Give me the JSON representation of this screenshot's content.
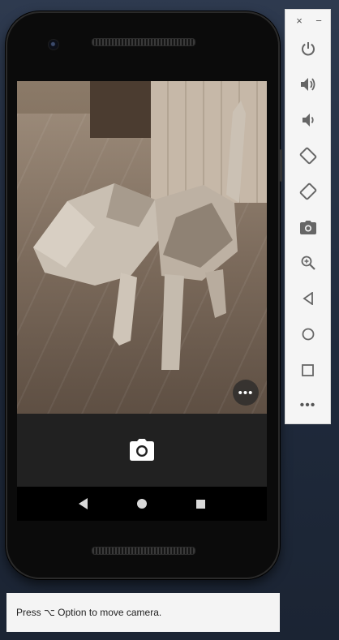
{
  "phone": {
    "nav": {
      "back": "back-icon",
      "home": "home-icon",
      "recents": "recents-icon"
    },
    "camera_app": {
      "shutter_icon": "camera-icon",
      "menu_icon": "more-horizontal-icon",
      "menu_glyph": "•••"
    }
  },
  "emulator_toolbar": {
    "close_glyph": "×",
    "minimize_glyph": "−",
    "more_glyph": "•••",
    "items": [
      "power-icon",
      "volume-up-icon",
      "volume-down-icon",
      "rotate-left-icon",
      "rotate-right-icon",
      "screenshot-icon",
      "zoom-icon",
      "back-icon",
      "home-icon",
      "overview-icon",
      "more-icon"
    ],
    "accent_color": "#666666"
  },
  "hint": {
    "text": "Press ⌥ Option to move camera."
  }
}
